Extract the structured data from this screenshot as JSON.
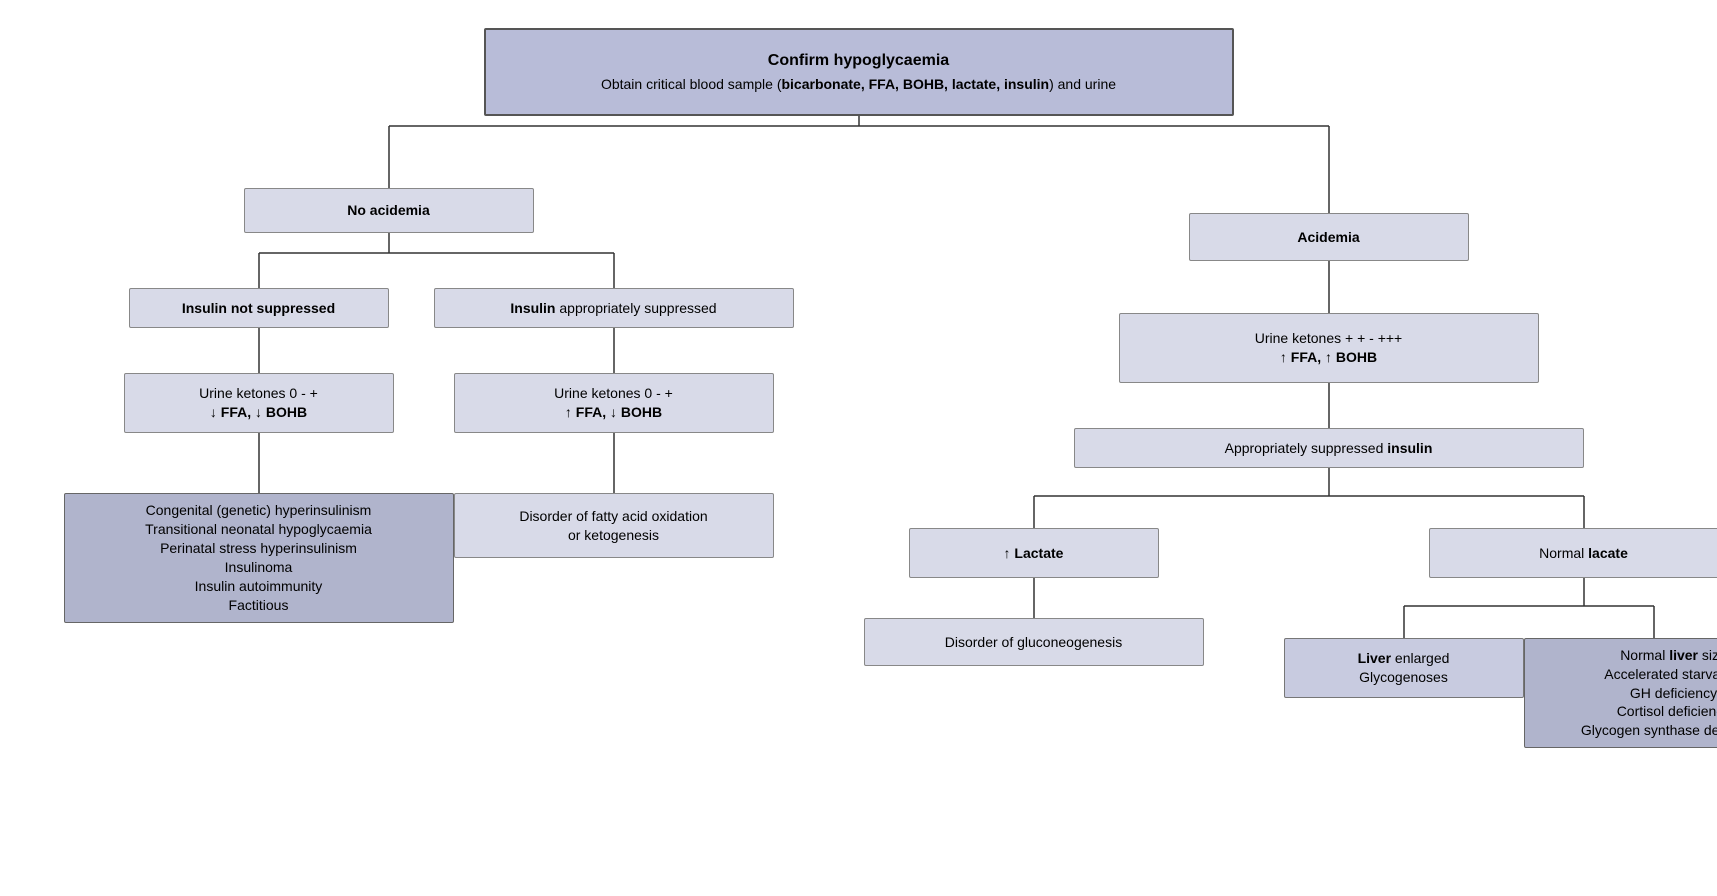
{
  "title": "Confirm hypoglycaemia",
  "subtitle": "Obtain critical blood sample (bicarbonate, FFA, BOHB, lactate, insulin) and urine",
  "nodes": {
    "root": {
      "label_plain": "Confirm hypoglycaemia",
      "label_sub": "Obtain critical blood sample (bicarbonate, FFA, BOHB, lactate, insulin) and urine"
    },
    "no_acidemia": {
      "label": "No acidemia"
    },
    "acidemia": {
      "label": "Acidemia"
    },
    "insulin_not_suppressed": {
      "label": "Insulin not suppressed"
    },
    "insulin_appropriately_suppressed": {
      "label": "Insulin appropriately suppressed"
    },
    "urine_ketones_0_left": {
      "label": "Urine ketones 0 - +\n↓ FFA, ↓ BOHB"
    },
    "urine_ketones_0_right": {
      "label": "Urine ketones 0 - +\n↑ FFA, ↓ BOHB"
    },
    "urine_ketones_pp": {
      "label": "Urine ketones + + - +++\n↑ FFA, ↑ BOHB"
    },
    "congenital": {
      "label": "Congenital (genetic) hyperinsulinism\nTransitional neonatal hypoglycaemia\nPerinatal stress hyperinsulinism\nInsulinoma\nInsulin autoimmunity\nFactitious"
    },
    "disorder_fatty": {
      "label": "Disorder of fatty acid oxidation\nor ketogenesis"
    },
    "appropriately_suppressed_insulin": {
      "label": "Appropriately suppressed insulin"
    },
    "lactate_up": {
      "label": "↑ Lactate"
    },
    "normal_lacate": {
      "label": "Normal lacate"
    },
    "disorder_gluco": {
      "label": "Disorder of gluconeogenesis"
    },
    "liver_enlarged": {
      "label": "Liver enlarged\nGlycogenoses"
    },
    "normal_liver": {
      "label": "Normal liver size\nAccelerated starvation\nGH deficiency\nCortisol deficiency\nGlycogen synthase deficiency"
    }
  }
}
